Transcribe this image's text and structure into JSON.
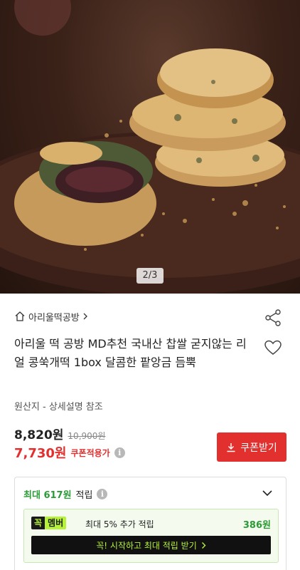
{
  "hero": {
    "pager": "2/3"
  },
  "seller": {
    "name": "아리울떡공방"
  },
  "product": {
    "title": "아리울 떡 공방 MD추천 국내산 찹쌀 굳지않는 리얼 콩쑥개떡 1box 달콤한 팥앙금 듬뿍",
    "origin": "원산지 - 상세설명 참조"
  },
  "price": {
    "sale": "8,820원",
    "original": "10,900원",
    "coupon_price": "7,730원",
    "coupon_label": "쿠폰적용가",
    "coupon_button": "쿠폰받기"
  },
  "reward": {
    "max_label": "최대 617원",
    "suffix": "적립",
    "member_badge_a": "꼭",
    "member_badge_b": "멤버",
    "member_desc": "최대 5% 추가 적립",
    "member_amount": "386원",
    "member_cta": "꼭! 시작하고 최대 적립 받기"
  },
  "colors": {
    "accent_red": "#e2302f",
    "accent_green": "#2a9b36",
    "lime": "#b6f23a"
  }
}
